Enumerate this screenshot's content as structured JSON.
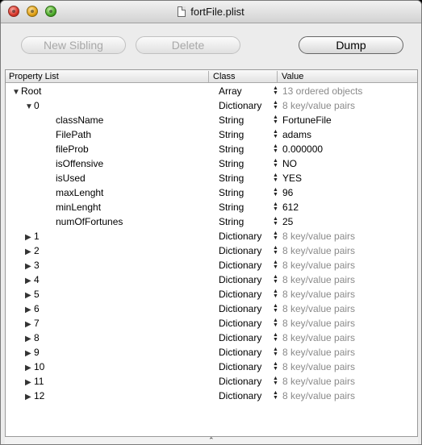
{
  "window": {
    "title": "fortFile.plist"
  },
  "toolbar": {
    "new_sibling": "New Sibling",
    "delete": "Delete",
    "dump": "Dump"
  },
  "table": {
    "headers": {
      "property": "Property List",
      "class": "Class",
      "value": "Value"
    },
    "rows": [
      {
        "name": "Root",
        "class": "Array",
        "value": "13 ordered objects",
        "disclosure": "▼",
        "indent": 8,
        "muted": true
      },
      {
        "name": "0",
        "class": "Dictionary",
        "value": "8 key/value pairs",
        "disclosure": "▼",
        "indent": 24,
        "muted": true
      },
      {
        "name": "className",
        "class": "String",
        "value": "FortuneFile",
        "disclosure": "",
        "indent": 51,
        "muted": false
      },
      {
        "name": "FilePath",
        "class": "String",
        "value": "adams",
        "disclosure": "",
        "indent": 51,
        "muted": false
      },
      {
        "name": "fileProb",
        "class": "String",
        "value": "0.000000",
        "disclosure": "",
        "indent": 51,
        "muted": false
      },
      {
        "name": "isOffensive",
        "class": "String",
        "value": "NO",
        "disclosure": "",
        "indent": 51,
        "muted": false
      },
      {
        "name": "isUsed",
        "class": "String",
        "value": "YES",
        "disclosure": "",
        "indent": 51,
        "muted": false
      },
      {
        "name": "maxLenght",
        "class": "String",
        "value": "96",
        "disclosure": "",
        "indent": 51,
        "muted": false
      },
      {
        "name": "minLenght",
        "class": "String",
        "value": "612",
        "disclosure": "",
        "indent": 51,
        "muted": false
      },
      {
        "name": "numOfFortunes",
        "class": "String",
        "value": "25",
        "disclosure": "",
        "indent": 51,
        "muted": false
      },
      {
        "name": "1",
        "class": "Dictionary",
        "value": "8 key/value pairs",
        "disclosure": "▶",
        "indent": 24,
        "muted": true
      },
      {
        "name": "2",
        "class": "Dictionary",
        "value": "8 key/value pairs",
        "disclosure": "▶",
        "indent": 24,
        "muted": true
      },
      {
        "name": "3",
        "class": "Dictionary",
        "value": "8 key/value pairs",
        "disclosure": "▶",
        "indent": 24,
        "muted": true
      },
      {
        "name": "4",
        "class": "Dictionary",
        "value": "8 key/value pairs",
        "disclosure": "▶",
        "indent": 24,
        "muted": true
      },
      {
        "name": "5",
        "class": "Dictionary",
        "value": "8 key/value pairs",
        "disclosure": "▶",
        "indent": 24,
        "muted": true
      },
      {
        "name": "6",
        "class": "Dictionary",
        "value": "8 key/value pairs",
        "disclosure": "▶",
        "indent": 24,
        "muted": true
      },
      {
        "name": "7",
        "class": "Dictionary",
        "value": "8 key/value pairs",
        "disclosure": "▶",
        "indent": 24,
        "muted": true
      },
      {
        "name": "8",
        "class": "Dictionary",
        "value": "8 key/value pairs",
        "disclosure": "▶",
        "indent": 24,
        "muted": true
      },
      {
        "name": "9",
        "class": "Dictionary",
        "value": "8 key/value pairs",
        "disclosure": "▶",
        "indent": 24,
        "muted": true
      },
      {
        "name": "10",
        "class": "Dictionary",
        "value": "8 key/value pairs",
        "disclosure": "▶",
        "indent": 24,
        "muted": true
      },
      {
        "name": "11",
        "class": "Dictionary",
        "value": "8 key/value pairs",
        "disclosure": "▶",
        "indent": 24,
        "muted": true
      },
      {
        "name": "12",
        "class": "Dictionary",
        "value": "8 key/value pairs",
        "disclosure": "▶",
        "indent": 24,
        "muted": true
      }
    ]
  },
  "icons": {
    "stepper": "stepper-arrows-icon",
    "splitter": "chevron-up-icon",
    "document": "document-icon"
  }
}
